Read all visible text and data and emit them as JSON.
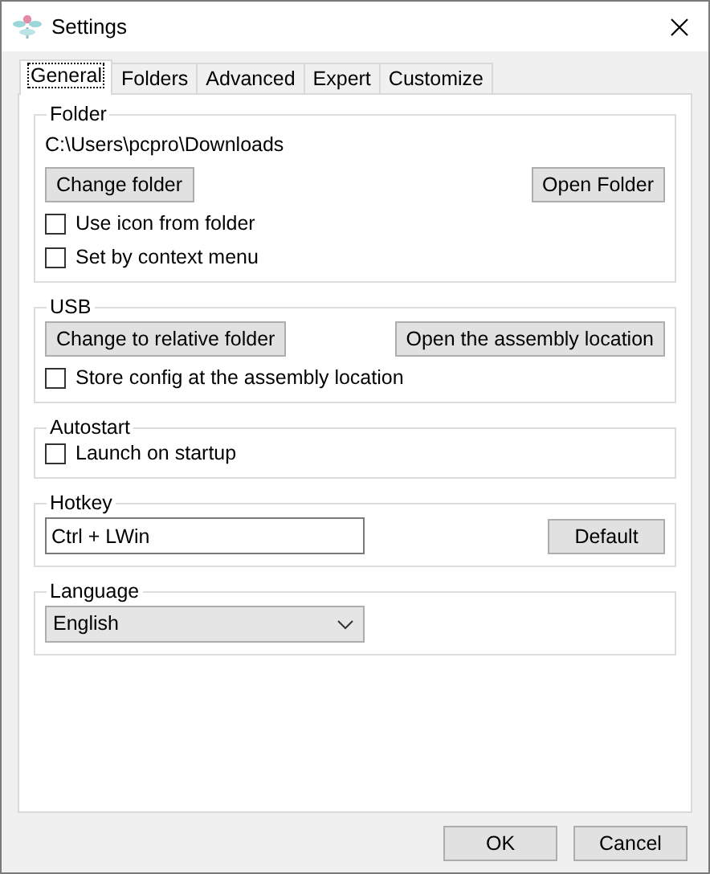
{
  "window": {
    "title": "Settings"
  },
  "tabs": [
    {
      "label": "General",
      "selected": true
    },
    {
      "label": "Folders",
      "selected": false
    },
    {
      "label": "Advanced",
      "selected": false
    },
    {
      "label": "Expert",
      "selected": false
    },
    {
      "label": "Customize",
      "selected": false
    }
  ],
  "groups": [
    {
      "title": "Folder",
      "rows": [
        {
          "kind": "text",
          "text": "C:\\Users\\pcpro\\Downloads"
        },
        {
          "kind": "buttons",
          "buttons": [
            "Change folder",
            "Open Folder"
          ]
        },
        {
          "kind": "checkbox",
          "label": "Use icon from folder",
          "checked": false
        },
        {
          "kind": "checkbox",
          "label": "Set by context menu",
          "checked": false
        }
      ]
    },
    {
      "title": "USB",
      "rows": [
        {
          "kind": "buttons",
          "buttons": [
            "Change to relative folder",
            "Open the assembly location"
          ]
        },
        {
          "kind": "checkbox",
          "label": "Store config at the assembly location",
          "checked": false
        }
      ]
    },
    {
      "title": "Autostart",
      "rows": [
        {
          "kind": "checkbox",
          "label": "Launch on startup",
          "checked": false
        }
      ]
    },
    {
      "title": "Hotkey",
      "rows": [
        {
          "kind": "field",
          "value": "Ctrl + LWin",
          "button": "Default"
        }
      ]
    },
    {
      "title": "Language",
      "rows": [
        {
          "kind": "select",
          "value": "English"
        }
      ]
    }
  ],
  "buttons": [
    "OK",
    "Cancel"
  ]
}
